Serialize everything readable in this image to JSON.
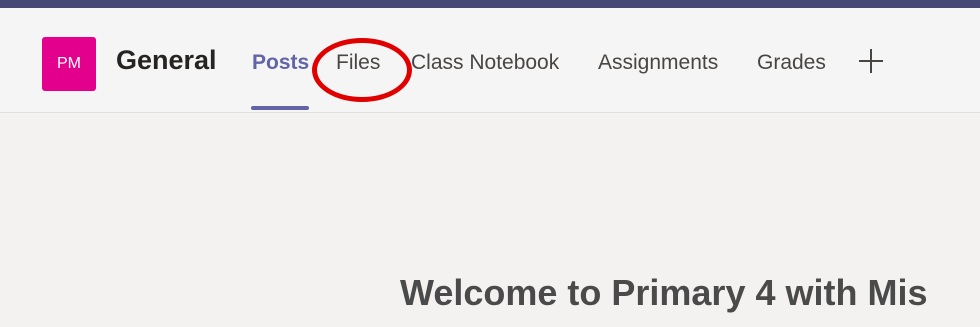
{
  "channel": {
    "avatar_initials": "PM",
    "avatar_color": "#e3008c",
    "title": "General"
  },
  "tabs": [
    {
      "label": "Posts",
      "active": true
    },
    {
      "label": "Files",
      "active": false,
      "highlighted": true
    },
    {
      "label": "Class Notebook",
      "active": false
    },
    {
      "label": "Assignments",
      "active": false
    },
    {
      "label": "Grades",
      "active": false
    }
  ],
  "add_tab_icon": "plus-icon",
  "accent_color": "#6264a7",
  "highlight_color": "#e00000",
  "main": {
    "welcome_text": "Welcome to Primary 4 with Mis"
  }
}
